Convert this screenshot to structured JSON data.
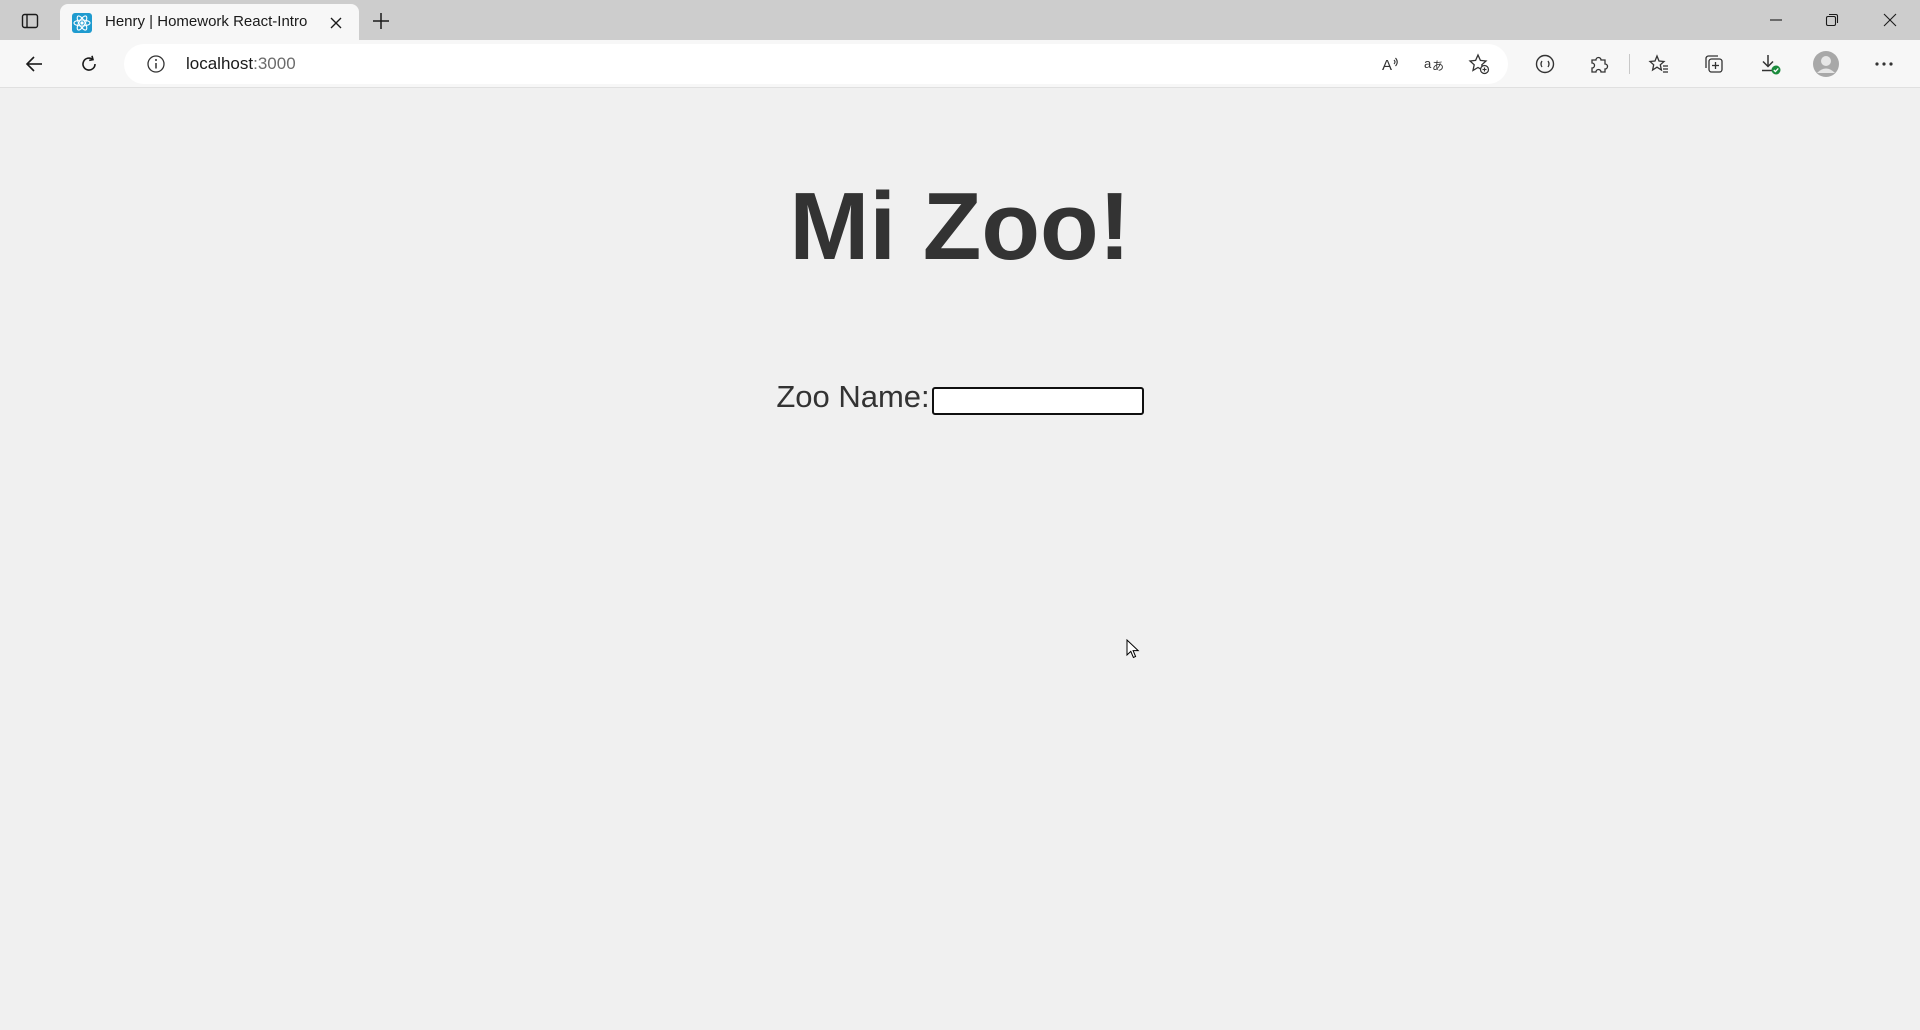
{
  "browser": {
    "tab": {
      "title": "Henry | Homework React-Intro",
      "favicon": "react-logo-icon"
    },
    "address_bar": {
      "host": "localhost",
      "port": ":3000"
    },
    "icons": {
      "tab_actions": "tab-actions-icon",
      "new_tab": "plus-icon",
      "back": "back-arrow-icon",
      "refresh": "refresh-icon",
      "site_info": "info-icon",
      "read_aloud": "read-aloud-icon",
      "translate": "translate-icon",
      "add_favorite": "star-plus-icon",
      "tracking": "tracking-prevention-icon",
      "extensions": "puzzle-icon",
      "favorites": "favorites-icon",
      "collections": "collections-icon",
      "downloads": "download-icon",
      "profile": "avatar-icon",
      "more": "more-dots-icon",
      "minimize": "minimize-icon",
      "restore": "restore-icon",
      "close": "close-icon"
    },
    "colors": {
      "tabstrip": "#cdcdcd",
      "toolbar": "#f7f7f7",
      "react_blue": "#1f9bcf",
      "download_badge": "#1a8b3c"
    }
  },
  "page": {
    "heading": "Mi Zoo!",
    "zoo_name_label": "Zoo Name:",
    "zoo_name_value": "",
    "zoo_name_placeholder": "",
    "colors": {
      "background": "#f0f0f0",
      "text": "#333333"
    }
  }
}
